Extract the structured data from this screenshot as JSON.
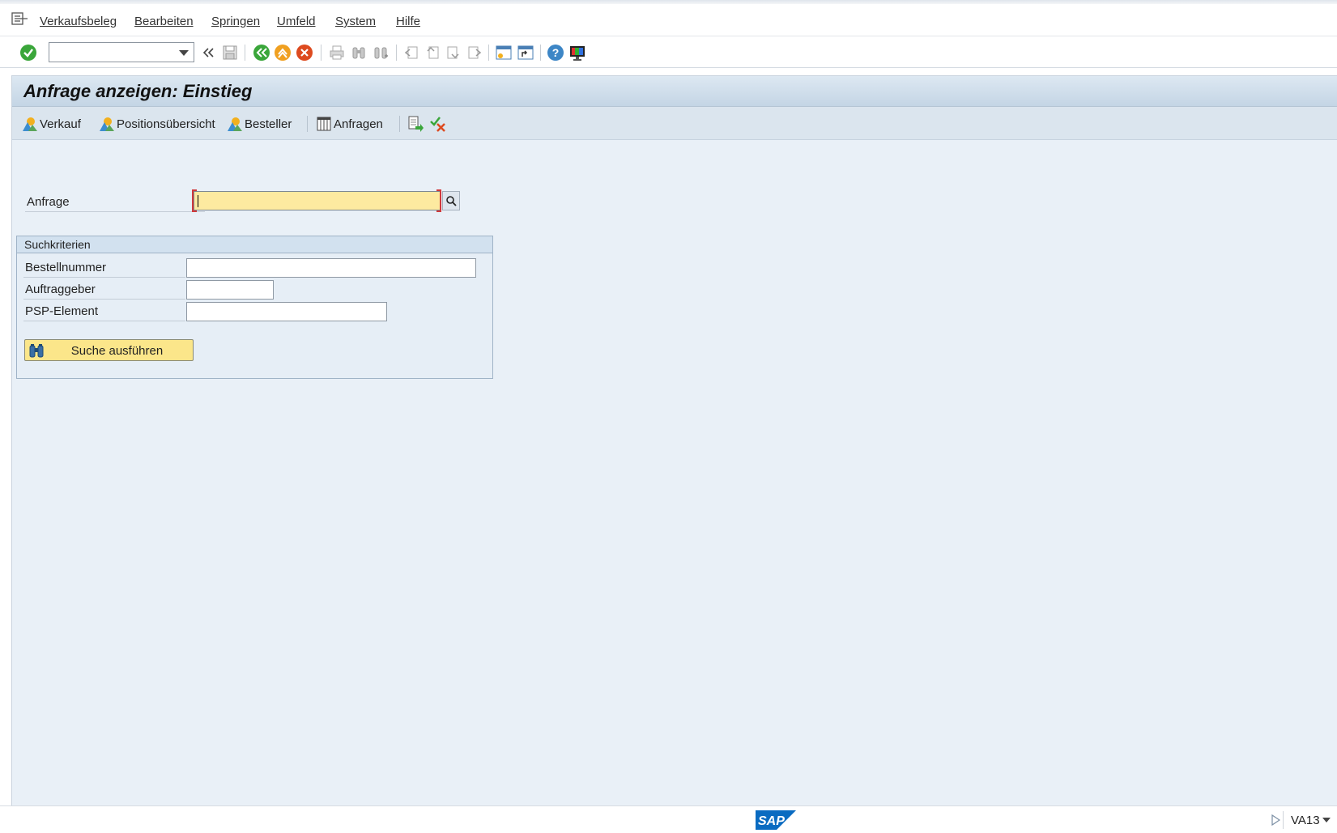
{
  "menu": {
    "items": [
      {
        "label": "Verkaufsbeleg"
      },
      {
        "label": "Bearbeiten"
      },
      {
        "label": "Springen"
      },
      {
        "label": "Umfeld"
      },
      {
        "label": "System"
      },
      {
        "label": "Hilfe"
      }
    ]
  },
  "toolbar": {
    "command_field_value": "",
    "icons": [
      "enter-icon",
      "collapse-icon",
      "save-icon",
      "back-icon",
      "exit-icon",
      "cancel-icon",
      "print-icon",
      "find-icon",
      "find-next-icon",
      "first-page-icon",
      "previous-page-icon",
      "next-page-icon",
      "last-page-icon",
      "create-session-icon",
      "create-shortcut-icon",
      "help-icon",
      "customize-layout-icon"
    ]
  },
  "screen": {
    "title": "Anfrage anzeigen: Einstieg"
  },
  "app_toolbar": {
    "buttons": [
      {
        "label": "Verkauf"
      },
      {
        "label": "Positionsübersicht"
      },
      {
        "label": "Besteller"
      },
      {
        "label": "Anfragen"
      }
    ]
  },
  "form": {
    "anfrage_label": "Anfrage",
    "anfrage_value": "",
    "group_title": "Suchkriterien",
    "fields": [
      {
        "label": "Bestellnummer",
        "value": ""
      },
      {
        "label": "Auftraggeber",
        "value": ""
      },
      {
        "label": "PSP-Element",
        "value": ""
      }
    ],
    "search_button_label": "Suche ausführen"
  },
  "status": {
    "logo": "SAP",
    "transaction": "VA13"
  },
  "colors": {
    "required_field": "#fdeaa0",
    "search_button": "#fbe68a",
    "background": "#e9f0f7",
    "sap_blue": "#0a6bc1"
  }
}
